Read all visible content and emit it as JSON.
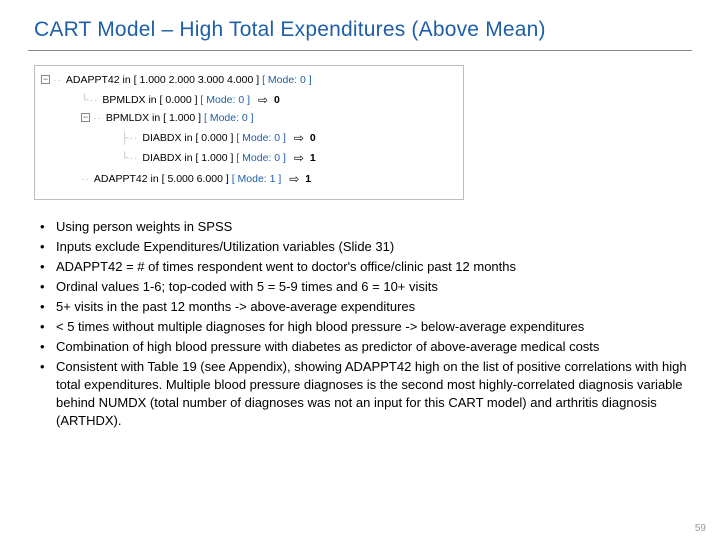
{
  "title": "CART Model – High Total Expenditures (Above Mean)",
  "tree": {
    "r0": {
      "toggle": "−",
      "var": "ADAPPT42 in [ 1.000 2.000 3.000 4.000 ]",
      "mode": "[ Mode: 0 ]"
    },
    "r1": {
      "var": "BPMLDX in [ 0.000 ]",
      "mode": "[ Mode: 0 ]",
      "result": "0"
    },
    "r2": {
      "toggle": "−",
      "var": "BPMLDX in [ 1.000 ]",
      "mode": "[ Mode: 0 ]"
    },
    "r3": {
      "var": "DIABDX in [ 0.000 ]",
      "mode": "[ Mode: 0 ]",
      "result": "0"
    },
    "r4": {
      "var": "DIABDX in [ 1.000 ]",
      "mode": "[ Mode: 0 ]",
      "result": "1"
    },
    "r5": {
      "var": "ADAPPT42 in [ 5.000 6.000 ]",
      "mode": "[ Mode: 1 ]",
      "result": "1"
    }
  },
  "bullets": {
    "b0": "Using person weights in SPSS",
    "b1": "Inputs exclude Expenditures/Utilization variables (Slide 31)",
    "b2": "ADAPPT42 = # of times respondent went to doctor's office/clinic past 12 months",
    "b3": "Ordinal values 1-6; top-coded with 5 = 5-9 times and 6 = 10+ visits",
    "b4": "5+ visits in the past 12 months -> above-average expenditures",
    "b5": "< 5 times without multiple diagnoses for high blood pressure -> below-average expenditures",
    "b6": "Combination of high blood pressure with diabetes as predictor of above-average medical costs",
    "b7": "Consistent with Table 19 (see Appendix), showing ADAPPT42 high on the list of positive correlations with high total expenditures.  Multiple blood pressure diagnoses is the second most highly-correlated diagnosis variable behind NUMDX (total number of diagnoses was not an input for this CART model) and arthritis diagnosis (ARTHDX)."
  },
  "page_number": "59"
}
